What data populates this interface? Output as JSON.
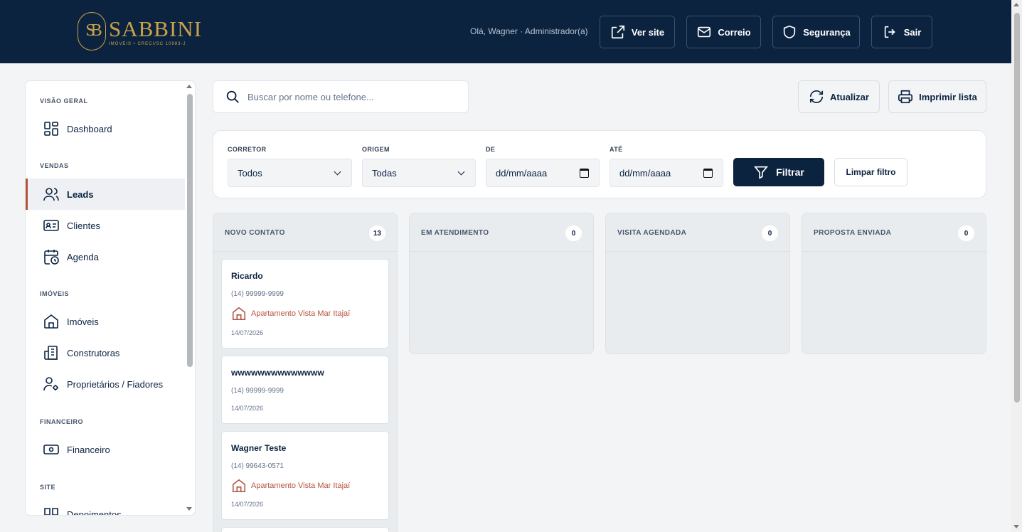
{
  "brand": {
    "name": "SABBINI",
    "tagline": "IMÓVEIS • CRECI/SC 10983-J",
    "monogram": "SB",
    "gold": "#c9a24a",
    "navy": "#0c2340"
  },
  "header": {
    "greeting": "Olá, Wagner · Administrador(a)",
    "buttons": [
      {
        "label": "Ver site",
        "icon": "external-link-icon"
      },
      {
        "label": "Correio",
        "icon": "mail-icon"
      },
      {
        "label": "Segurança",
        "icon": "shield-icon"
      },
      {
        "label": "Sair",
        "icon": "logout-icon"
      }
    ]
  },
  "sidebar": {
    "sections": [
      {
        "title": "VISÃO GERAL"
      },
      {
        "title": "VENDAS"
      },
      {
        "title": "IMÓVEIS"
      },
      {
        "title": "FINANCEIRO"
      },
      {
        "title": "SITE"
      }
    ],
    "items": [
      {
        "label": "Dashboard",
        "icon": "grid-icon"
      },
      {
        "label": "Leads",
        "icon": "users-icon",
        "active": true
      },
      {
        "label": "Clientes",
        "icon": "id-card-icon"
      },
      {
        "label": "Agenda",
        "icon": "calendar-clock-icon"
      },
      {
        "label": "Imóveis",
        "icon": "house-icon"
      },
      {
        "label": "Construtoras",
        "icon": "building-icon"
      },
      {
        "label": "Proprietários / Fiadores",
        "icon": "user-gear-icon"
      },
      {
        "label": "Financeiro",
        "icon": "banknote-icon"
      },
      {
        "label": "Depoimentos",
        "icon": "quote-icon"
      }
    ]
  },
  "search": {
    "placeholder": "Buscar por nome ou telefone..."
  },
  "toolbar": {
    "refresh_label": "Atualizar",
    "print_label": "Imprimir lista"
  },
  "filters": {
    "corretor_label": "CORRETOR",
    "corretor_value": "Todos",
    "origem_label": "ORIGEM",
    "origem_value": "Todas",
    "de_label": "DE",
    "de_value": "dd/mm/aaaa",
    "ate_label": "ATÉ",
    "ate_value": "dd/mm/aaaa",
    "filter_label": "Filtrar",
    "clear_label": "Limpar filtro"
  },
  "kanban": {
    "columns": [
      {
        "title": "NOVO CONTATO",
        "count": "13"
      },
      {
        "title": "EM ATENDIMENTO",
        "count": "0"
      },
      {
        "title": "VISITA AGENDADA",
        "count": "0"
      },
      {
        "title": "PROPOSTA ENVIADA",
        "count": "0"
      }
    ],
    "cards": [
      {
        "name": "Ricardo",
        "phone": "(14) 99999-9999",
        "property": "Apartamento Vista Mar Itajaí",
        "date": "14/07/2026"
      },
      {
        "name": "wwwwwwwwwwwwww",
        "phone": "(14) 99999-9999",
        "date": "14/07/2026"
      },
      {
        "name": "Wagner Teste",
        "phone": "(14) 99643-0571",
        "property": "Apartamento Vista Mar Itajaí",
        "date": "14/07/2026"
      }
    ]
  }
}
